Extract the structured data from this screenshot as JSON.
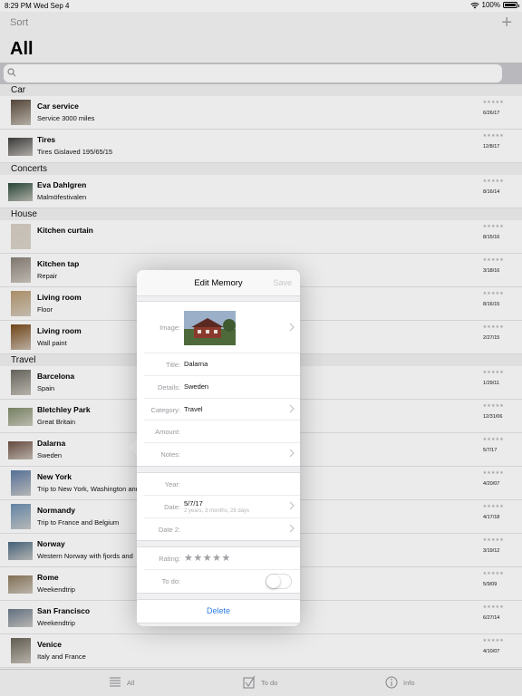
{
  "status": {
    "time": "8:29 PM",
    "date": "Wed Sep 4",
    "battery": "100%",
    "battery_fraction": 1.0
  },
  "header": {
    "sort_label": "Sort",
    "add_label": "+",
    "title": "All"
  },
  "search": {
    "placeholder": ""
  },
  "sections": [
    {
      "header": "Car",
      "rows": [
        {
          "title": "Car service",
          "sub": "Service 3000 miles",
          "date": "6/26/17",
          "thumb": "tall",
          "thumb_color": "#5a4a3c"
        },
        {
          "title": "Tires",
          "sub": "Tires Gislaved 195/65/15",
          "date": "12/8/17",
          "thumb": "wide",
          "thumb_color": "#3e3e3e"
        }
      ]
    },
    {
      "header": "Concerts",
      "rows": [
        {
          "title": "Eva Dahlgren",
          "sub": "Malmöfestivalen",
          "date": "8/16/14",
          "thumb": "wide",
          "thumb_color": "#2a4a3a"
        }
      ]
    },
    {
      "header": "House",
      "rows": [
        {
          "title": "Kitchen curtain",
          "sub": "",
          "date": "8/15/16",
          "thumb": "tall",
          "thumb_color": "#d8d0c4"
        },
        {
          "title": "Kitchen tap",
          "sub": "Repair",
          "date": "3/18/16",
          "thumb": "tall",
          "thumb_color": "#8a8178"
        },
        {
          "title": "Living room",
          "sub": "Floor",
          "date": "8/16/15",
          "thumb": "tall",
          "thumb_color": "#b89a70"
        },
        {
          "title": "Living room",
          "sub": "Wall paint",
          "date": "2/27/15",
          "thumb": "tall",
          "thumb_color": "#7a4a1a"
        }
      ]
    },
    {
      "header": "Travel",
      "rows": [
        {
          "title": "Barcelona",
          "sub": "Spain",
          "date": "1/29/11",
          "thumb": "tall",
          "thumb_color": "#6c6a62"
        },
        {
          "title": "Bletchley Park",
          "sub": "Great Britain",
          "date": "12/31/06",
          "thumb": "wide",
          "thumb_color": "#7f8c6a"
        },
        {
          "title": "Dalarna",
          "sub": "Sweden",
          "date": "5/7/17",
          "thumb": "wide",
          "thumb_color": "#6d5044"
        },
        {
          "title": "New York",
          "sub": "Trip to New York, Washington and",
          "date": "4/20/07",
          "thumb": "tall",
          "thumb_color": "#5c7aa4"
        },
        {
          "title": "Normandy",
          "sub": "Trip to France and Belgium",
          "date": "4/17/18",
          "thumb": "tall",
          "thumb_color": "#6b8fb3"
        },
        {
          "title": "Norway",
          "sub": "Western Norway with fjords and",
          "date": "3/19/12",
          "thumb": "wide",
          "thumb_color": "#4a6a84"
        },
        {
          "title": "Rome",
          "sub": "Weekendtrip",
          "date": "5/9/09",
          "thumb": "wide",
          "thumb_color": "#8c7a5c"
        },
        {
          "title": "San Francisco",
          "sub": "Weekendtrip",
          "date": "6/27/14",
          "thumb": "wide",
          "thumb_color": "#6a7a8c"
        },
        {
          "title": "Venice",
          "sub": "Italy and France",
          "date": "4/10/07",
          "thumb": "tall",
          "thumb_color": "#6a6458"
        }
      ]
    }
  ],
  "popover": {
    "title": "Edit Memory",
    "save_label": "Save",
    "image_label": "Image:",
    "title_label": "Title:",
    "title_value": "Dalarna",
    "details_label": "Details:",
    "details_value": "Sweden",
    "category_label": "Category:",
    "category_value": "Travel",
    "amount_label": "Amount:",
    "notes_label": "Notes:",
    "year_label": "Year:",
    "date_label": "Date:",
    "date_value": "5/7/17",
    "date_sub": "2 years, 3 months, 28 days",
    "date2_label": "Date 2:",
    "rating_label": "Rating:",
    "rating_value": 0,
    "rating_max": 5,
    "todo_label": "To do:",
    "todo_on": false,
    "delete_label": "Delete"
  },
  "tabs": [
    {
      "label": "All",
      "icon": "list-icon"
    },
    {
      "label": "To do",
      "icon": "checkbox-icon"
    },
    {
      "label": "Info",
      "icon": "info-icon"
    }
  ]
}
